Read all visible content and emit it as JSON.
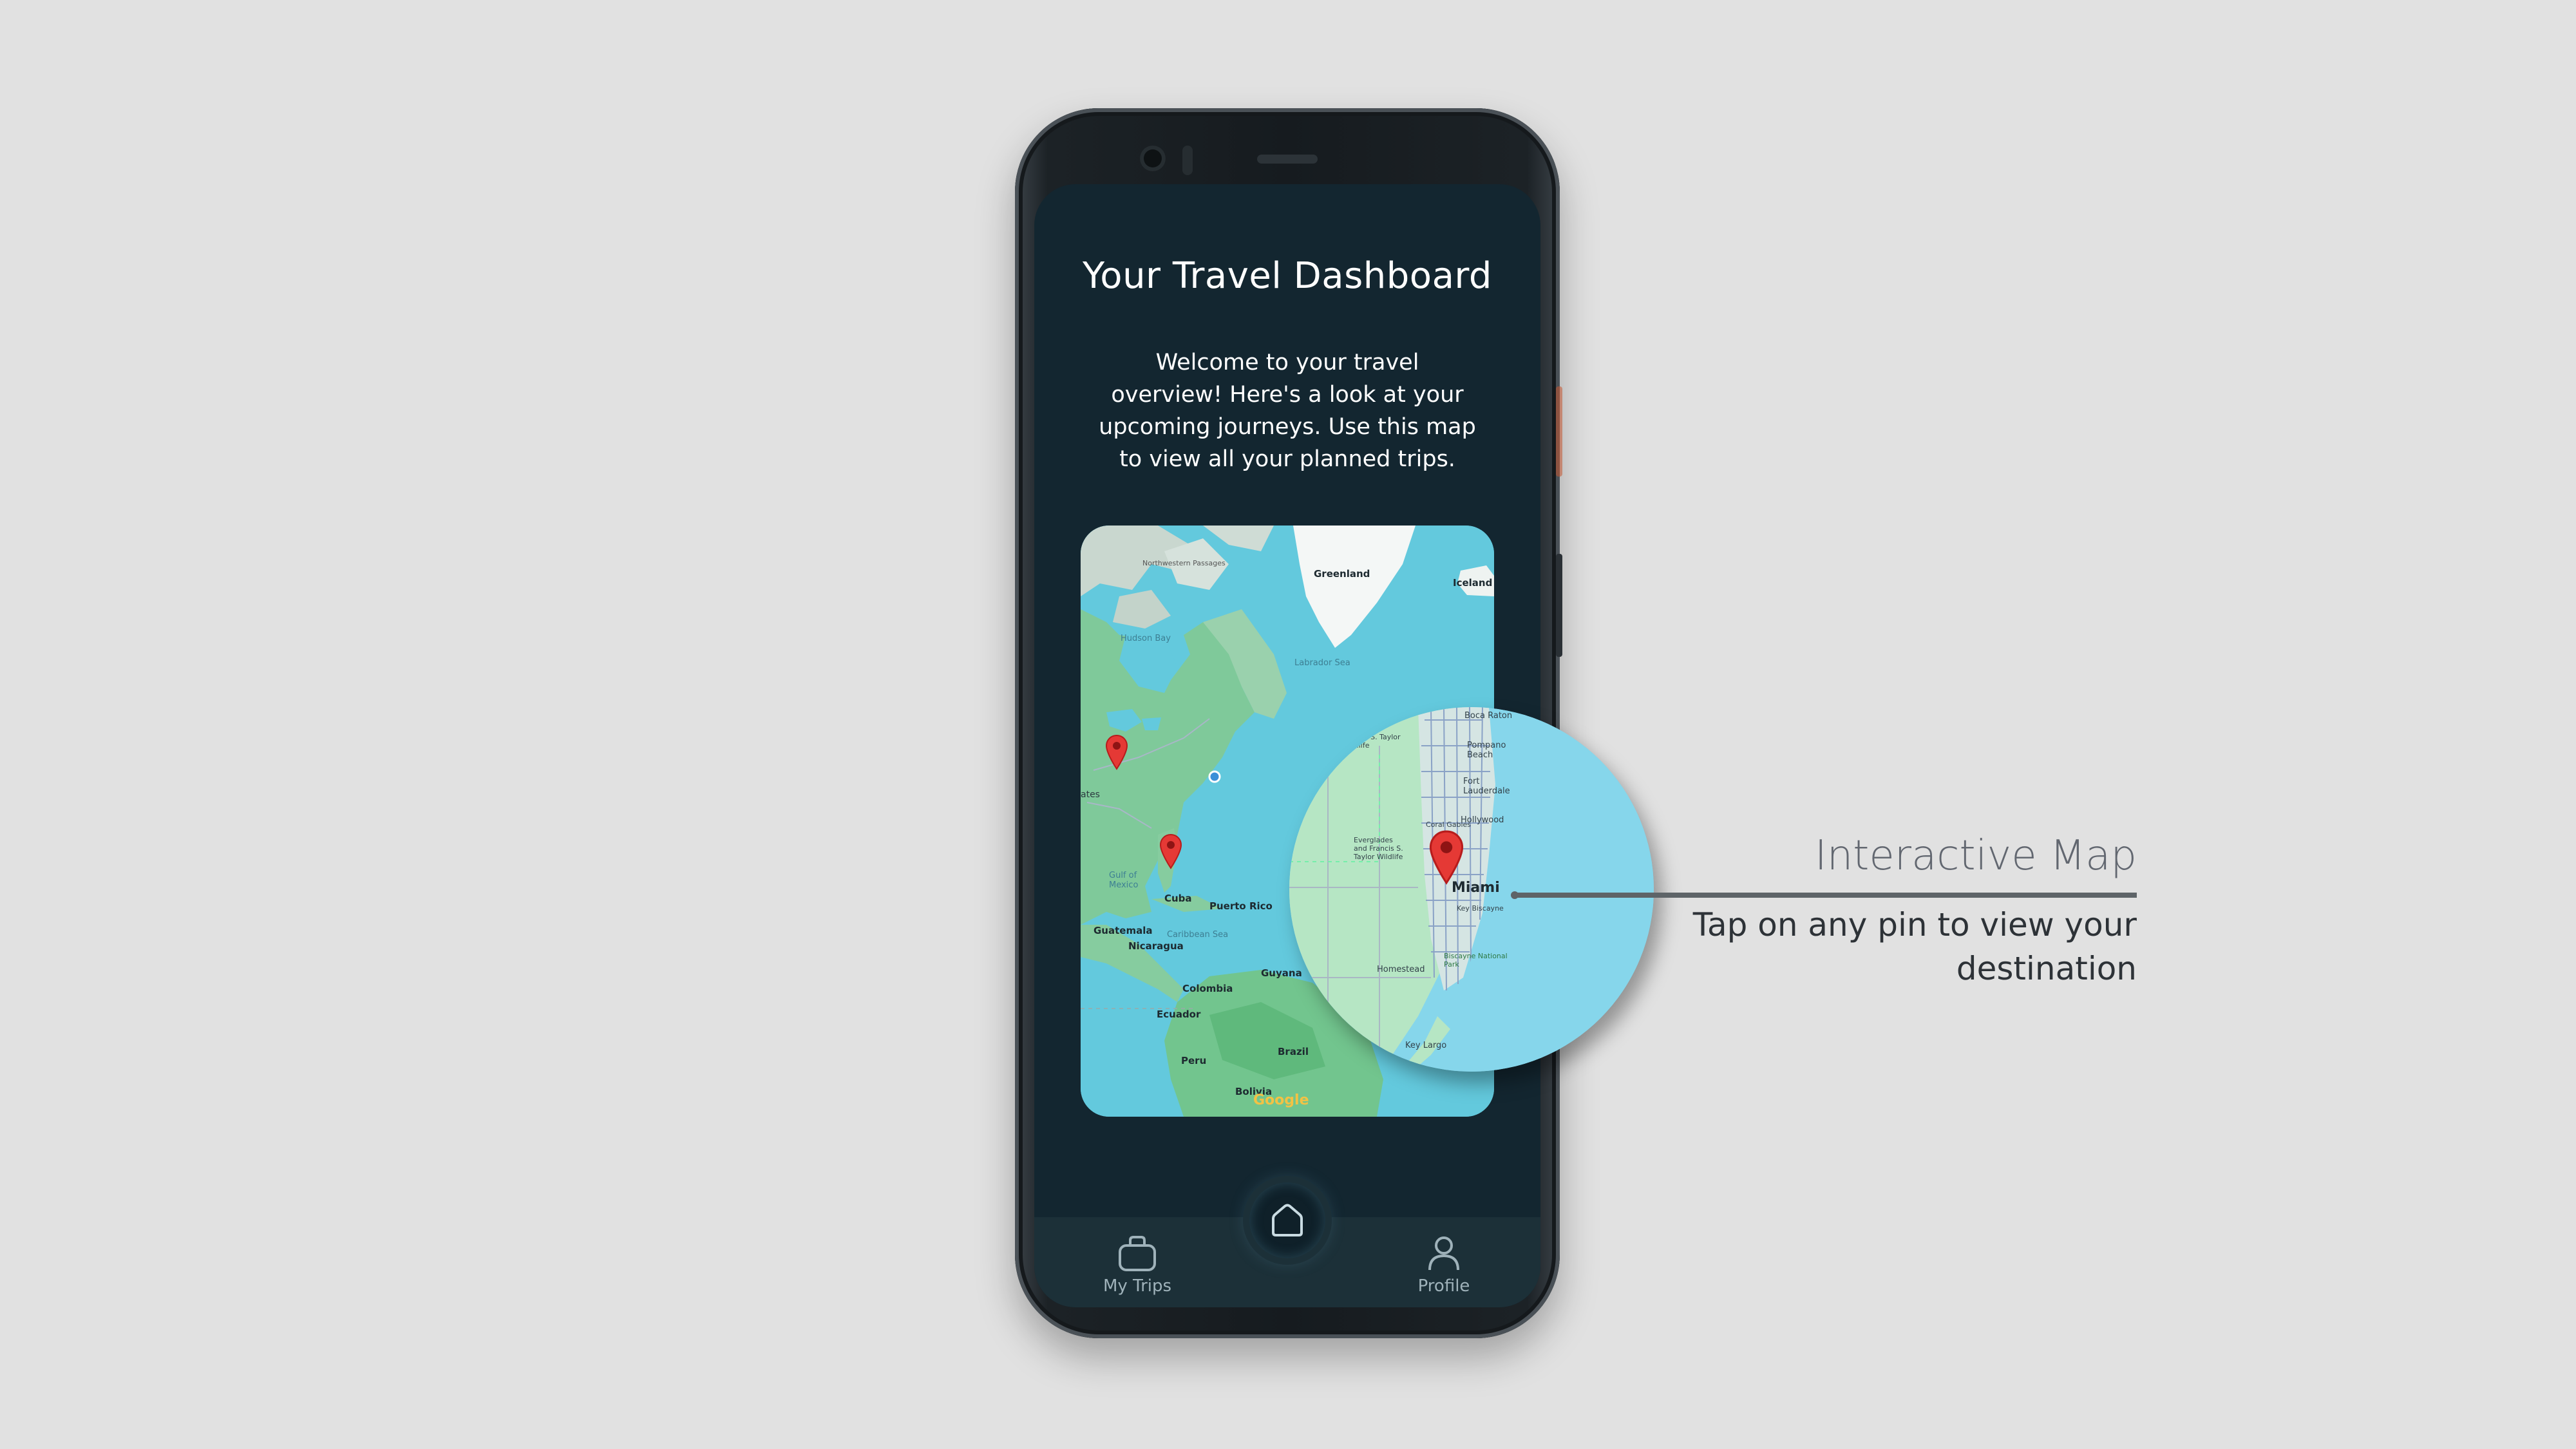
{
  "screen": {
    "title": "Your Travel Dashboard",
    "welcome": "Welcome to your travel overview! Here's a look at your upcoming journeys. Use this map to view all your planned trips."
  },
  "map": {
    "labels": {
      "greenland": "Greenland",
      "iceland": "Iceland",
      "northwestern_passages": "Northwestern Passages",
      "hudson_bay": "Hudson Bay",
      "labrador_sea": "Labrador Sea",
      "states": "ates",
      "gulf_of_mexico": "Gulf of Mexico",
      "cuba": "Cuba",
      "puerto_rico": "Puerto Rico",
      "caribbean_sea": "Caribbean Sea",
      "guatemala": "Guatemala",
      "nicaragua": "Nicaragua",
      "colombia": "Colombia",
      "guyana": "Guyana",
      "ecuador": "Ecuador",
      "brazil": "Brazil",
      "peru": "Peru",
      "bolivia": "Bolivia",
      "google": "Google"
    },
    "pin_color": "#e53935",
    "water_color": "#63c9dd",
    "land_color": "#8fd3a6"
  },
  "magnifier": {
    "labels": {
      "boca_raton": "Boca Raton",
      "pompano_beach": "Pompano Beach",
      "fort_lauderdale": "Fort Lauderdale",
      "hollywood": "Hollywood",
      "miami": "Miami",
      "homestead": "Homestead",
      "key_largo": "Key Largo",
      "biscayne": "Biscayne National Park",
      "everglades": "Everglades and Francis S. Taylor Wildlife",
      "francis_taylor": "Francis S. Taylor Wildlife",
      "key_biscayne": "Key Biscayne",
      "coral_gables": "Coral Gables"
    }
  },
  "nav": {
    "trips_label": "My Trips",
    "profile_label": "Profile",
    "trips_icon": "bag-icon",
    "home_icon": "home-icon",
    "profile_icon": "person-icon"
  },
  "callout": {
    "title": "Interactive Map",
    "description": "Tap on any pin to view your destination"
  },
  "colors": {
    "background": "#e1e1e1",
    "screen": "#132630",
    "nav": "#1c3038",
    "callout_line": "#5e6468"
  }
}
